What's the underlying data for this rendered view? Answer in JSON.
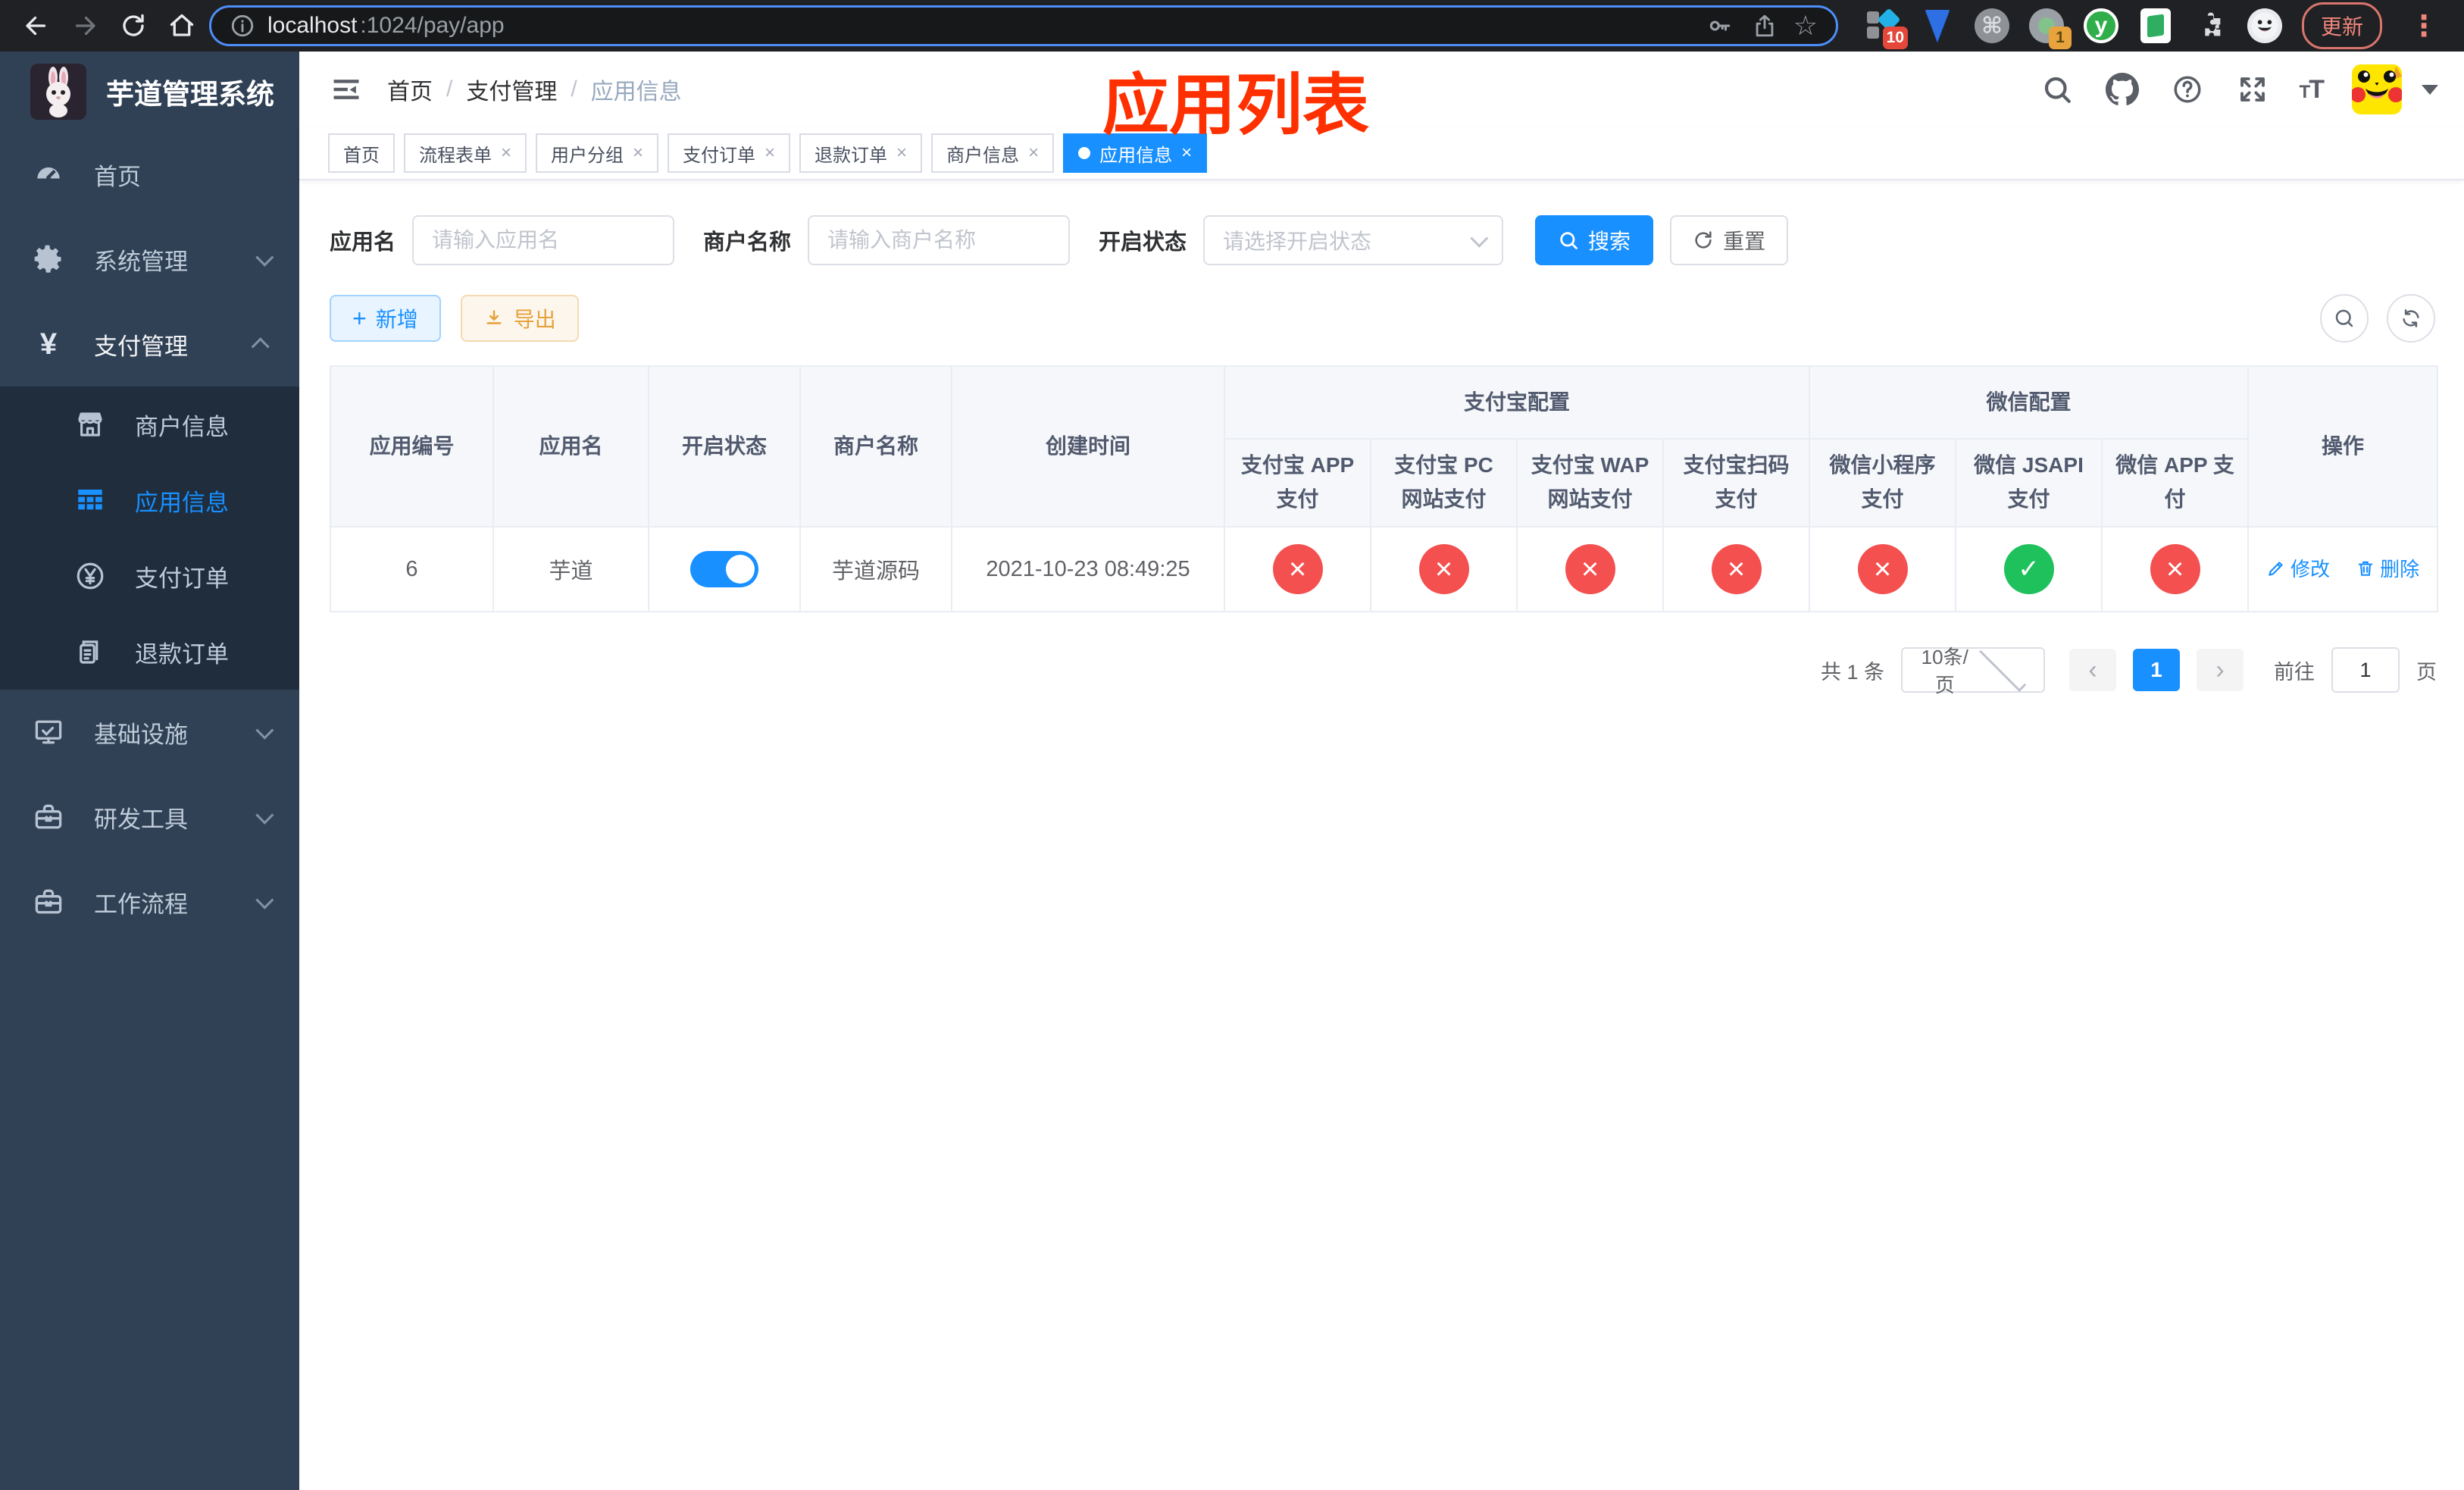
{
  "browser": {
    "url": {
      "host": "localhost",
      "path": ":1024/pay/app"
    },
    "update_label": "更新",
    "extension_badges": {
      "pinned": "10",
      "proxy": "1"
    },
    "extension_y": "y"
  },
  "colors": {
    "primary": "#1890ff",
    "danger": "#f4504f",
    "success": "#1fc15c",
    "sidebar_bg": "#304156",
    "submenu_bg": "#1f2d3d",
    "annotation_red": "#ff3000",
    "export_orange": "#e6a23c"
  },
  "icons": {
    "browser": [
      "back-arrow",
      "forward-arrow",
      "reload",
      "home",
      "info-circle",
      "key",
      "share",
      "star"
    ],
    "navbar": [
      "collapse-sidebar",
      "search",
      "github",
      "help-circle",
      "fullscreen",
      "font-size",
      "avatar-caret"
    ],
    "sidebar": [
      "dashboard-gauge",
      "gear",
      "yen",
      "shop",
      "grid-table",
      "yen-circle",
      "document",
      "monitor-check",
      "toolbox",
      "briefcase"
    ],
    "glyphs": {
      "close": "×",
      "check": "✓",
      "cross": "×",
      "prev": "‹",
      "next": "›",
      "command": "⌘",
      "star": "☆"
    }
  },
  "sidebar": {
    "logo_title": "芋道管理系统",
    "items": {
      "home": "首页",
      "system": "系统管理",
      "payment": "支付管理",
      "infra": "基础设施",
      "devtools": "研发工具",
      "workflow": "工作流程"
    },
    "payment_children": {
      "merchant": "商户信息",
      "app": "应用信息",
      "pay_order": "支付订单",
      "refund_order": "退款订单"
    }
  },
  "navbar": {
    "breadcrumb": [
      "首页",
      "支付管理",
      "应用信息"
    ],
    "separator": "/",
    "annotation": "应用列表"
  },
  "tabs": [
    {
      "label": "首页",
      "closable": false,
      "active": false
    },
    {
      "label": "流程表单",
      "closable": true,
      "active": false
    },
    {
      "label": "用户分组",
      "closable": true,
      "active": false
    },
    {
      "label": "支付订单",
      "closable": true,
      "active": false
    },
    {
      "label": "退款订单",
      "closable": true,
      "active": false
    },
    {
      "label": "商户信息",
      "closable": true,
      "active": false
    },
    {
      "label": "应用信息",
      "closable": true,
      "active": true
    }
  ],
  "filters": {
    "app_name_label": "应用名",
    "app_name_placeholder": "请输入应用名",
    "merchant_label": "商户名称",
    "merchant_placeholder": "请输入商户名称",
    "status_label": "开启状态",
    "status_placeholder": "请选择开启状态",
    "search_label": "搜索",
    "reset_label": "重置"
  },
  "toolbar": {
    "add_label": "新增",
    "export_label": "导出"
  },
  "table": {
    "col_app_id": "应用编号",
    "col_app_name": "应用名",
    "col_status": "开启状态",
    "col_merchant": "商户名称",
    "col_created": "创建时间",
    "group_alipay": "支付宝配置",
    "group_wechat": "微信配置",
    "col_alipay_app": "支付宝 APP 支付",
    "col_alipay_pc": "支付宝 PC 网站支付",
    "col_alipay_wap": "支付宝 WAP 网站支付",
    "col_alipay_qr": "支付宝扫码支付",
    "col_wx_mini": "微信小程序支付",
    "col_wx_jsapi": "微信 JSAPI 支付",
    "col_wx_app": "微信 APP 支付",
    "col_actions": "操作",
    "row": {
      "app_id": "6",
      "app_name": "芋道",
      "status": "on",
      "merchant": "芋道源码",
      "created": "2021-10-23 08:49:25",
      "statuses": [
        "no",
        "no",
        "no",
        "no",
        "no",
        "yes",
        "no"
      ],
      "action_edit": "修改",
      "action_delete": "删除"
    }
  },
  "pagination": {
    "total": "共 1 条",
    "page_size": "10条/页",
    "page": "1",
    "goto_prefix": "前往",
    "goto_value": "1",
    "goto_suffix": "页"
  }
}
